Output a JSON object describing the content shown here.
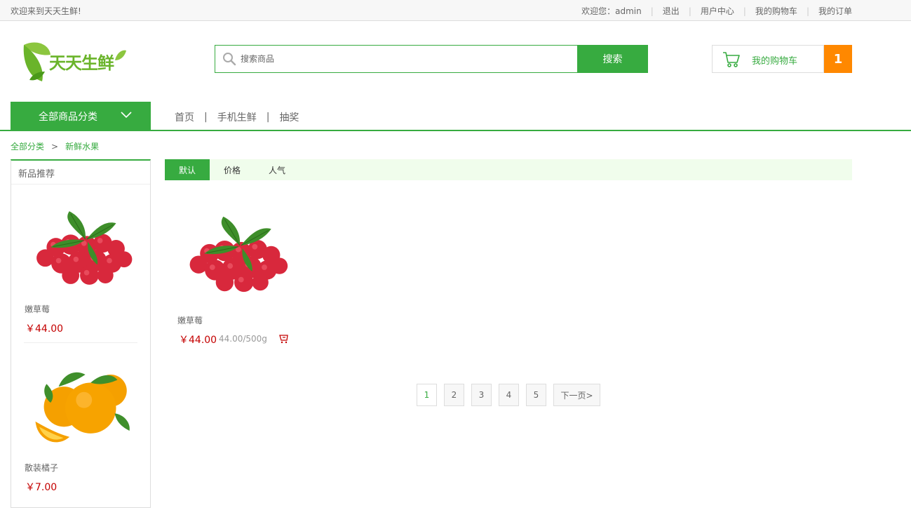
{
  "topbar": {
    "welcome": "欢迎来到天天生鲜!",
    "greeting": "欢迎您：",
    "username": "admin",
    "logout": "退出",
    "user_center": "用户中心",
    "my_cart": "我的购物车",
    "my_orders": "我的订单",
    "sep": "|"
  },
  "header": {
    "brand": "天天生鲜",
    "search_placeholder": "搜索商品",
    "search_button": "搜索",
    "cart_label": "我的购物车",
    "cart_count": "1"
  },
  "nav": {
    "all_categories": "全部商品分类",
    "links": [
      "首页",
      "手机生鲜",
      "抽奖"
    ],
    "sep": "|"
  },
  "breadcrumb": {
    "root": "全部分类",
    "arrow": ">",
    "current": "新鲜水果"
  },
  "sidebar": {
    "title": "新品推荐",
    "items": [
      {
        "name": "嫩草莓",
        "price": "￥44.00",
        "image": "raspberry"
      },
      {
        "name": "散装橘子",
        "price": "￥7.00",
        "image": "orange"
      }
    ]
  },
  "sort": {
    "tabs": [
      "默认",
      "价格",
      "人气"
    ],
    "active": 0
  },
  "products": [
    {
      "name": "嫩草莓",
      "price": "￥44.00",
      "unit": "44.00/500g",
      "image": "raspberry"
    }
  ],
  "pagination": {
    "pages": [
      "1",
      "2",
      "3",
      "4",
      "5"
    ],
    "current": "1",
    "next": "下一页>"
  },
  "colors": {
    "accent": "#37ab40",
    "cart_badge": "#ff8800",
    "price": "#c40000",
    "sort_bg": "#f0fdec"
  }
}
